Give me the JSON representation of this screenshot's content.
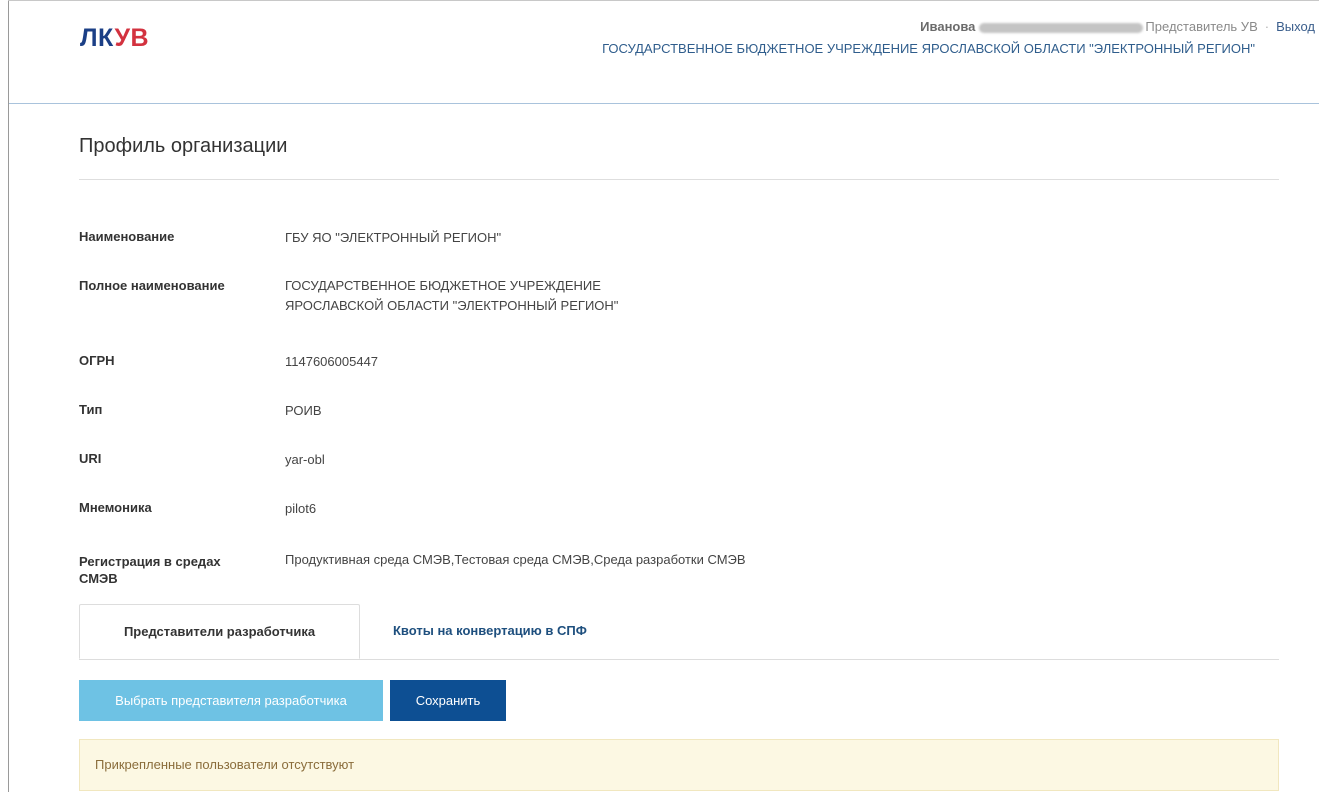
{
  "header": {
    "logo_part1": "ЛК",
    "logo_part2": "УВ",
    "user_name": "Иванова",
    "user_role": "Представитель УВ",
    "separator": "·",
    "logout_label": "Выход",
    "organization": "ГОСУДАРСТВЕННОЕ БЮДЖЕТНОЕ УЧРЕЖДЕНИЕ ЯРОСЛАВСКОЙ ОБЛАСТИ \"ЭЛЕКТРОННЫЙ РЕГИОН\""
  },
  "page": {
    "title": "Профиль организации"
  },
  "profile": {
    "fields": [
      {
        "label": "Наименование",
        "value": "ГБУ ЯО \"ЭЛЕКТРОННЫЙ РЕГИОН\""
      },
      {
        "label": "Полное наименование",
        "value_line1": "ГОСУДАРСТВЕННОЕ БЮДЖЕТНОЕ УЧРЕЖДЕНИЕ",
        "value_line2": "ЯРОСЛАВСКОЙ ОБЛАСТИ \"ЭЛЕКТРОННЫЙ РЕГИОН\""
      },
      {
        "label": "ОГРН",
        "value": "1147606005447"
      },
      {
        "label": "Тип",
        "value": "РОИВ"
      },
      {
        "label": "URI",
        "value": "yar-obl"
      },
      {
        "label": "Мнемоника",
        "value": "pilot6"
      },
      {
        "label_line1": "Регистрация в средах",
        "label_line2": "СМЭВ",
        "value": "Продуктивная среда СМЭВ,Тестовая среда СМЭВ,Среда разработки СМЭВ"
      }
    ]
  },
  "tabs": [
    {
      "label": "Представители разработчика",
      "active": true
    },
    {
      "label": "Квоты на конвертацию в СПФ",
      "active": false
    }
  ],
  "actions": {
    "select_label": "Выбрать представителя разработчика",
    "save_label": "Сохранить"
  },
  "alert": {
    "text": "Прикрепленные пользователи отсутствуют"
  },
  "colors": {
    "logo_primary": "#1b3f86",
    "logo_accent": "#d3323f",
    "select_button": "#6ec2e4",
    "save_button": "#0d4f93",
    "alert_bg": "#fcf8e3"
  }
}
